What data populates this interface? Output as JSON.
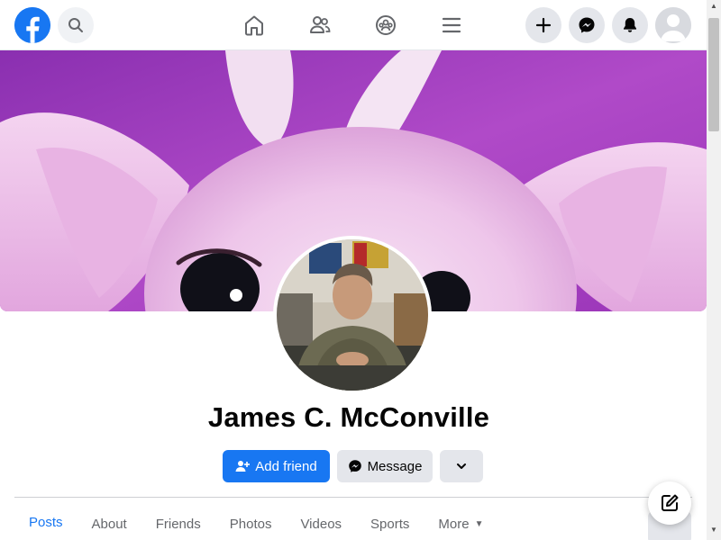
{
  "profile": {
    "name": "James C. McConville"
  },
  "actions": {
    "add_friend": "Add friend",
    "message": "Message"
  },
  "tabs": [
    {
      "label": "Posts"
    },
    {
      "label": "About"
    },
    {
      "label": "Friends"
    },
    {
      "label": "Photos"
    },
    {
      "label": "Videos"
    },
    {
      "label": "Sports"
    },
    {
      "label": "More"
    }
  ],
  "colors": {
    "brand": "#1877f2",
    "button_gray": "#e4e6eb",
    "text_secondary": "#65676b"
  },
  "icons": {
    "logo": "facebook-logo",
    "search": "search-icon",
    "home": "home-icon",
    "friends": "friends-icon",
    "groups": "groups-icon",
    "menu": "menu-icon",
    "create": "plus-icon",
    "messenger": "messenger-icon",
    "notifications": "bell-icon",
    "compose": "edit-icon"
  }
}
